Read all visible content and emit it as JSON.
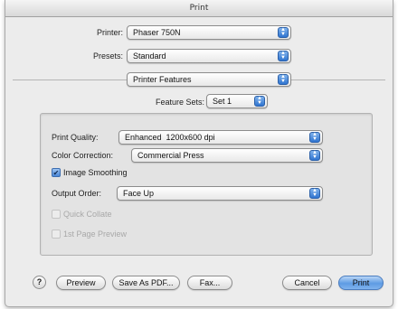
{
  "window": {
    "title": "Print"
  },
  "printer": {
    "label": "Printer:",
    "value": "Phaser 750N"
  },
  "presets": {
    "label": "Presets:",
    "value": "Standard"
  },
  "section": {
    "value": "Printer Features"
  },
  "feature_sets": {
    "label": "Feature Sets:",
    "value": "Set 1"
  },
  "features": {
    "print_quality": {
      "label": "Print Quality:",
      "value": "Enhanced  1200x600 dpi"
    },
    "color_correction": {
      "label": "Color Correction:",
      "value": "Commercial Press"
    },
    "image_smoothing": {
      "label": "Image Smoothing",
      "checked": true
    },
    "output_order": {
      "label": "Output Order:",
      "value": "Face Up"
    },
    "quick_collate": {
      "label": "Quick Collate",
      "checked": false,
      "enabled": false
    },
    "first_page_preview": {
      "label": "1st Page Preview",
      "checked": false,
      "enabled": false
    }
  },
  "buttons": {
    "help": "?",
    "preview": "Preview",
    "save_as_pdf": "Save As PDF...",
    "fax": "Fax...",
    "cancel": "Cancel",
    "print": "Print"
  },
  "icons": {
    "popup_arrows": "updown-arrows-icon",
    "checkmark": "checkmark-icon"
  },
  "colors": {
    "accent": "#4a87d6",
    "window_bg": "#ececec"
  }
}
